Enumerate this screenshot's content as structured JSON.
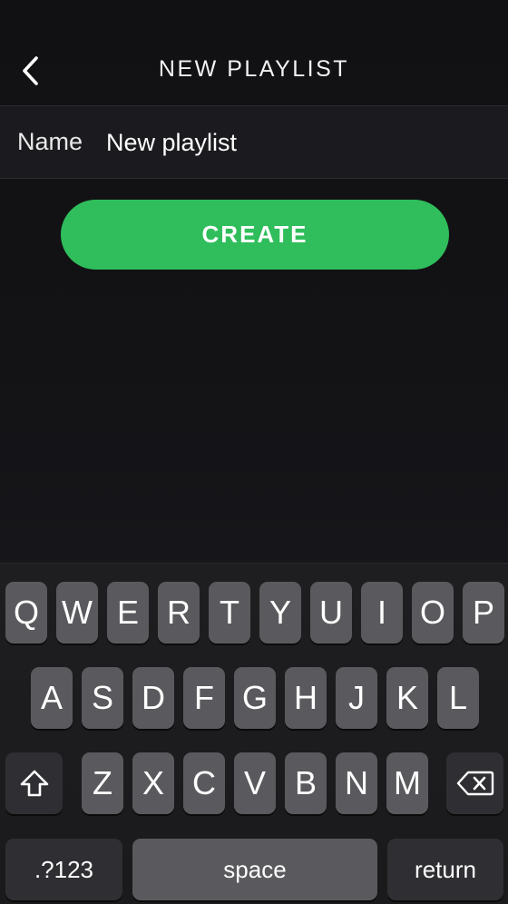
{
  "header": {
    "title": "NEW PLAYLIST",
    "back_icon": "chevron-left-icon"
  },
  "form": {
    "name_label": "Name",
    "name_value": "New playlist"
  },
  "actions": {
    "create_label": "CREATE"
  },
  "keyboard": {
    "row1": [
      "Q",
      "W",
      "E",
      "R",
      "T",
      "Y",
      "U",
      "I",
      "O",
      "P"
    ],
    "row2": [
      "A",
      "S",
      "D",
      "F",
      "G",
      "H",
      "J",
      "K",
      "L"
    ],
    "row3": [
      "Z",
      "X",
      "C",
      "V",
      "B",
      "N",
      "M"
    ],
    "shift_icon": "shift-icon",
    "backspace_icon": "backspace-icon",
    "numbers_label": ".?123",
    "space_label": "space",
    "return_label": "return"
  },
  "colors": {
    "accent": "#2fbe5b",
    "background": "#131316",
    "key": "#5a5a5e",
    "function_key": "#2f2f33"
  }
}
